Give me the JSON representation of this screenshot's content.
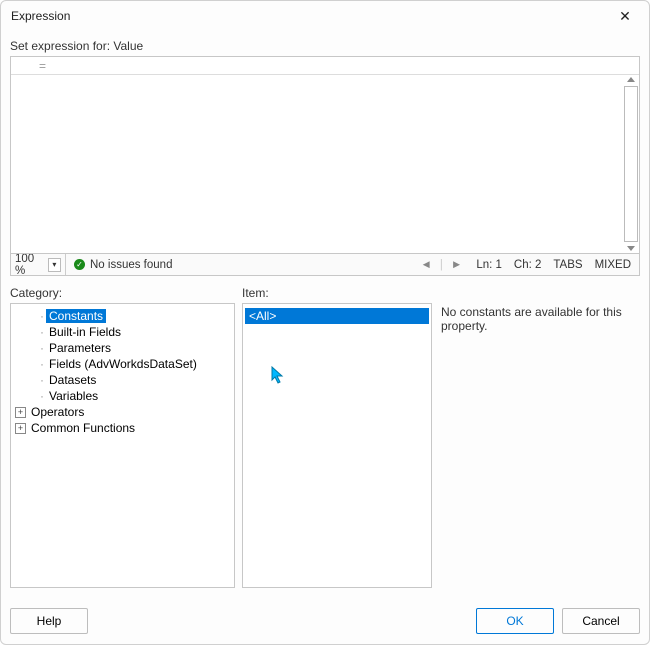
{
  "window": {
    "title": "Expression"
  },
  "labels": {
    "set_expr_for": "Set expression for: Value",
    "category": "Category:",
    "item": "Item:"
  },
  "editor": {
    "content": "=",
    "zoom": "100 %"
  },
  "status": {
    "issues": "No issues found",
    "nav_prev": "◄",
    "nav_next": "►",
    "line": "Ln: 1",
    "col": "Ch: 2",
    "tabs": "TABS",
    "mixed": "MIXED"
  },
  "category_tree": [
    {
      "label": "Constants",
      "level": 1,
      "expander": false,
      "selected": true
    },
    {
      "label": "Built-in Fields",
      "level": 1,
      "expander": false,
      "selected": false
    },
    {
      "label": "Parameters",
      "level": 1,
      "expander": false,
      "selected": false
    },
    {
      "label": "Fields (AdvWorkdsDataSet)",
      "level": 1,
      "expander": false,
      "selected": false
    },
    {
      "label": "Datasets",
      "level": 1,
      "expander": false,
      "selected": false
    },
    {
      "label": "Variables",
      "level": 1,
      "expander": false,
      "selected": false
    },
    {
      "label": "Operators",
      "level": 0,
      "expander": true,
      "selected": false
    },
    {
      "label": "Common Functions",
      "level": 0,
      "expander": true,
      "selected": false
    }
  ],
  "item_list": [
    {
      "label": "<All>",
      "selected": true
    }
  ],
  "description": "No constants are available for this property.",
  "footer": {
    "help": "Help",
    "ok": "OK",
    "cancel": "Cancel"
  }
}
